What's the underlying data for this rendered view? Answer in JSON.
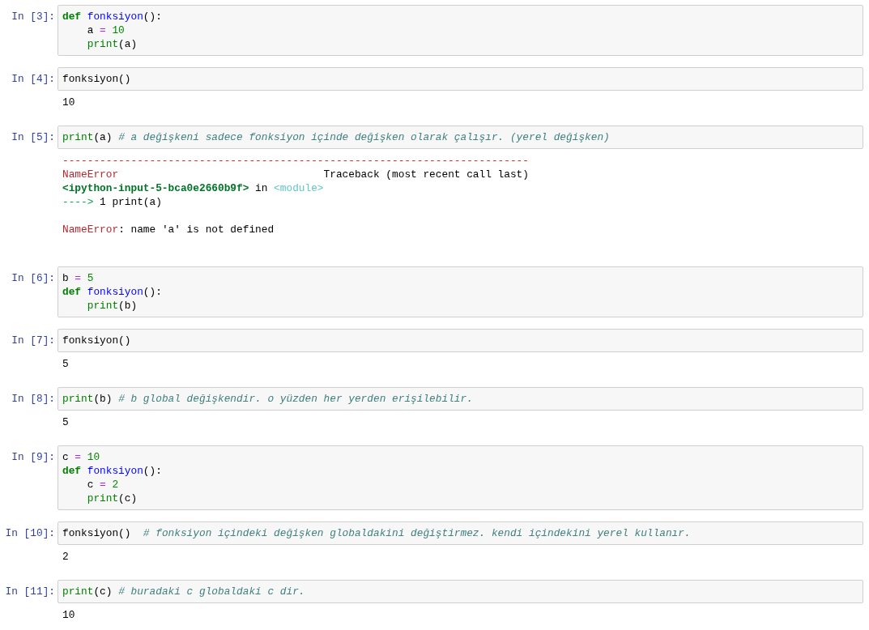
{
  "notebook": {
    "cells": [
      {
        "prompt": "In [3]:",
        "code": [
          {
            "tokens": [
              {
                "kind": "keyword",
                "text": "def "
              },
              {
                "kind": "def",
                "text": "fonksiyon"
              },
              {
                "kind": "plain",
                "text": "():"
              }
            ],
            "children": [
              {
                "tokens": [
                  {
                    "kind": "plain",
                    "text": "a"
                  },
                  {
                    "kind": "operator",
                    "text": " = "
                  },
                  {
                    "kind": "number",
                    "text": "10"
                  }
                ]
              },
              {
                "tokens": [
                  {
                    "kind": "builtin",
                    "text": "print"
                  },
                  {
                    "kind": "plain",
                    "text": "(a)"
                  }
                ]
              }
            ]
          }
        ]
      },
      {
        "prompt": "In [4]:",
        "code": [
          {
            "tokens": [
              {
                "kind": "plain",
                "text": "fonksiyon()"
              }
            ]
          }
        ],
        "output": {
          "kind": "stream",
          "paragraphs": [
            [
              {
                "tokens": [
                  {
                    "kind": "plain",
                    "text": "10"
                  }
                ]
              }
            ]
          ]
        }
      },
      {
        "prompt": "In [5]:",
        "code": [
          {
            "tokens": [
              {
                "kind": "builtin",
                "text": "print"
              },
              {
                "kind": "plain",
                "text": "(a) "
              },
              {
                "kind": "comment",
                "text": "# a değişkeni sadece fonksiyon içinde değişken olarak çalışır. (yerel değişken)"
              }
            ]
          }
        ],
        "output": {
          "kind": "error",
          "paragraphs": [
            [
              {
                "tokens": [
                  {
                    "kind": "ansi-red",
                    "text": "---------------------------------------------------------------------------"
                  }
                ]
              },
              {
                "tokens": [
                  {
                    "kind": "ansi-red",
                    "text": "NameError"
                  },
                  {
                    "kind": "plain",
                    "text": "                                 Traceback (most recent call last)"
                  }
                ]
              },
              {
                "tokens": [
                  {
                    "kind": "ansi-green-bold",
                    "text": "<ipython-input-5-bca0e2660b9f>"
                  },
                  {
                    "kind": "plain",
                    "text": " in "
                  },
                  {
                    "kind": "ansi-cyan",
                    "text": "<module>"
                  }
                ]
              },
              {
                "tokens": [
                  {
                    "kind": "ansi-green",
                    "text": "---->"
                  },
                  {
                    "kind": "plain",
                    "text": " 1 print(a)"
                  }
                ]
              }
            ],
            [
              {
                "tokens": [
                  {
                    "kind": "ansi-red",
                    "text": "NameError"
                  },
                  {
                    "kind": "plain",
                    "text": ": name 'a' is not defined"
                  }
                ]
              }
            ]
          ]
        }
      },
      {
        "prompt": "In [6]:",
        "code": [
          {
            "tokens": [
              {
                "kind": "plain",
                "text": "b"
              },
              {
                "kind": "operator",
                "text": " = "
              },
              {
                "kind": "number",
                "text": "5"
              }
            ]
          },
          {
            "tokens": [
              {
                "kind": "keyword",
                "text": "def "
              },
              {
                "kind": "def",
                "text": "fonksiyon"
              },
              {
                "kind": "plain",
                "text": "():"
              }
            ],
            "children": [
              {
                "tokens": [
                  {
                    "kind": "builtin",
                    "text": "print"
                  },
                  {
                    "kind": "plain",
                    "text": "(b)"
                  }
                ]
              }
            ]
          }
        ]
      },
      {
        "prompt": "In [7]:",
        "code": [
          {
            "tokens": [
              {
                "kind": "plain",
                "text": "fonksiyon()"
              }
            ]
          }
        ],
        "output": {
          "kind": "stream",
          "paragraphs": [
            [
              {
                "tokens": [
                  {
                    "kind": "plain",
                    "text": "5"
                  }
                ]
              }
            ]
          ]
        }
      },
      {
        "prompt": "In [8]:",
        "code": [
          {
            "tokens": [
              {
                "kind": "builtin",
                "text": "print"
              },
              {
                "kind": "plain",
                "text": "(b) "
              },
              {
                "kind": "comment",
                "text": "# b global değişkendir. o yüzden her yerden erişilebilir."
              }
            ]
          }
        ],
        "output": {
          "kind": "stream",
          "paragraphs": [
            [
              {
                "tokens": [
                  {
                    "kind": "plain",
                    "text": "5"
                  }
                ]
              }
            ]
          ]
        }
      },
      {
        "prompt": "In [9]:",
        "code": [
          {
            "tokens": [
              {
                "kind": "plain",
                "text": "c"
              },
              {
                "kind": "operator",
                "text": " = "
              },
              {
                "kind": "number",
                "text": "10"
              }
            ]
          },
          {
            "tokens": [
              {
                "kind": "keyword",
                "text": "def "
              },
              {
                "kind": "def",
                "text": "fonksiyon"
              },
              {
                "kind": "plain",
                "text": "():"
              }
            ],
            "children": [
              {
                "tokens": [
                  {
                    "kind": "plain",
                    "text": "c"
                  },
                  {
                    "kind": "operator",
                    "text": " = "
                  },
                  {
                    "kind": "number",
                    "text": "2"
                  }
                ]
              },
              {
                "tokens": [
                  {
                    "kind": "builtin",
                    "text": "print"
                  },
                  {
                    "kind": "plain",
                    "text": "(c)"
                  }
                ]
              }
            ]
          }
        ]
      },
      {
        "prompt": "In [10]:",
        "code": [
          {
            "tokens": [
              {
                "kind": "plain",
                "text": "fonksiyon()  "
              },
              {
                "kind": "comment",
                "text": "# fonksiyon içindeki değişken globaldakini değiştirmez. kendi içindekini yerel kullanır."
              }
            ]
          }
        ],
        "output": {
          "kind": "stream",
          "paragraphs": [
            [
              {
                "tokens": [
                  {
                    "kind": "plain",
                    "text": "2"
                  }
                ]
              }
            ]
          ]
        }
      },
      {
        "prompt": "In [11]:",
        "code": [
          {
            "tokens": [
              {
                "kind": "builtin",
                "text": "print"
              },
              {
                "kind": "plain",
                "text": "(c) "
              },
              {
                "kind": "comment",
                "text": "# buradaki c globaldaki c dir."
              }
            ]
          }
        ],
        "output": {
          "kind": "stream",
          "paragraphs": [
            [
              {
                "tokens": [
                  {
                    "kind": "plain",
                    "text": "10"
                  }
                ]
              }
            ]
          ]
        }
      }
    ]
  }
}
